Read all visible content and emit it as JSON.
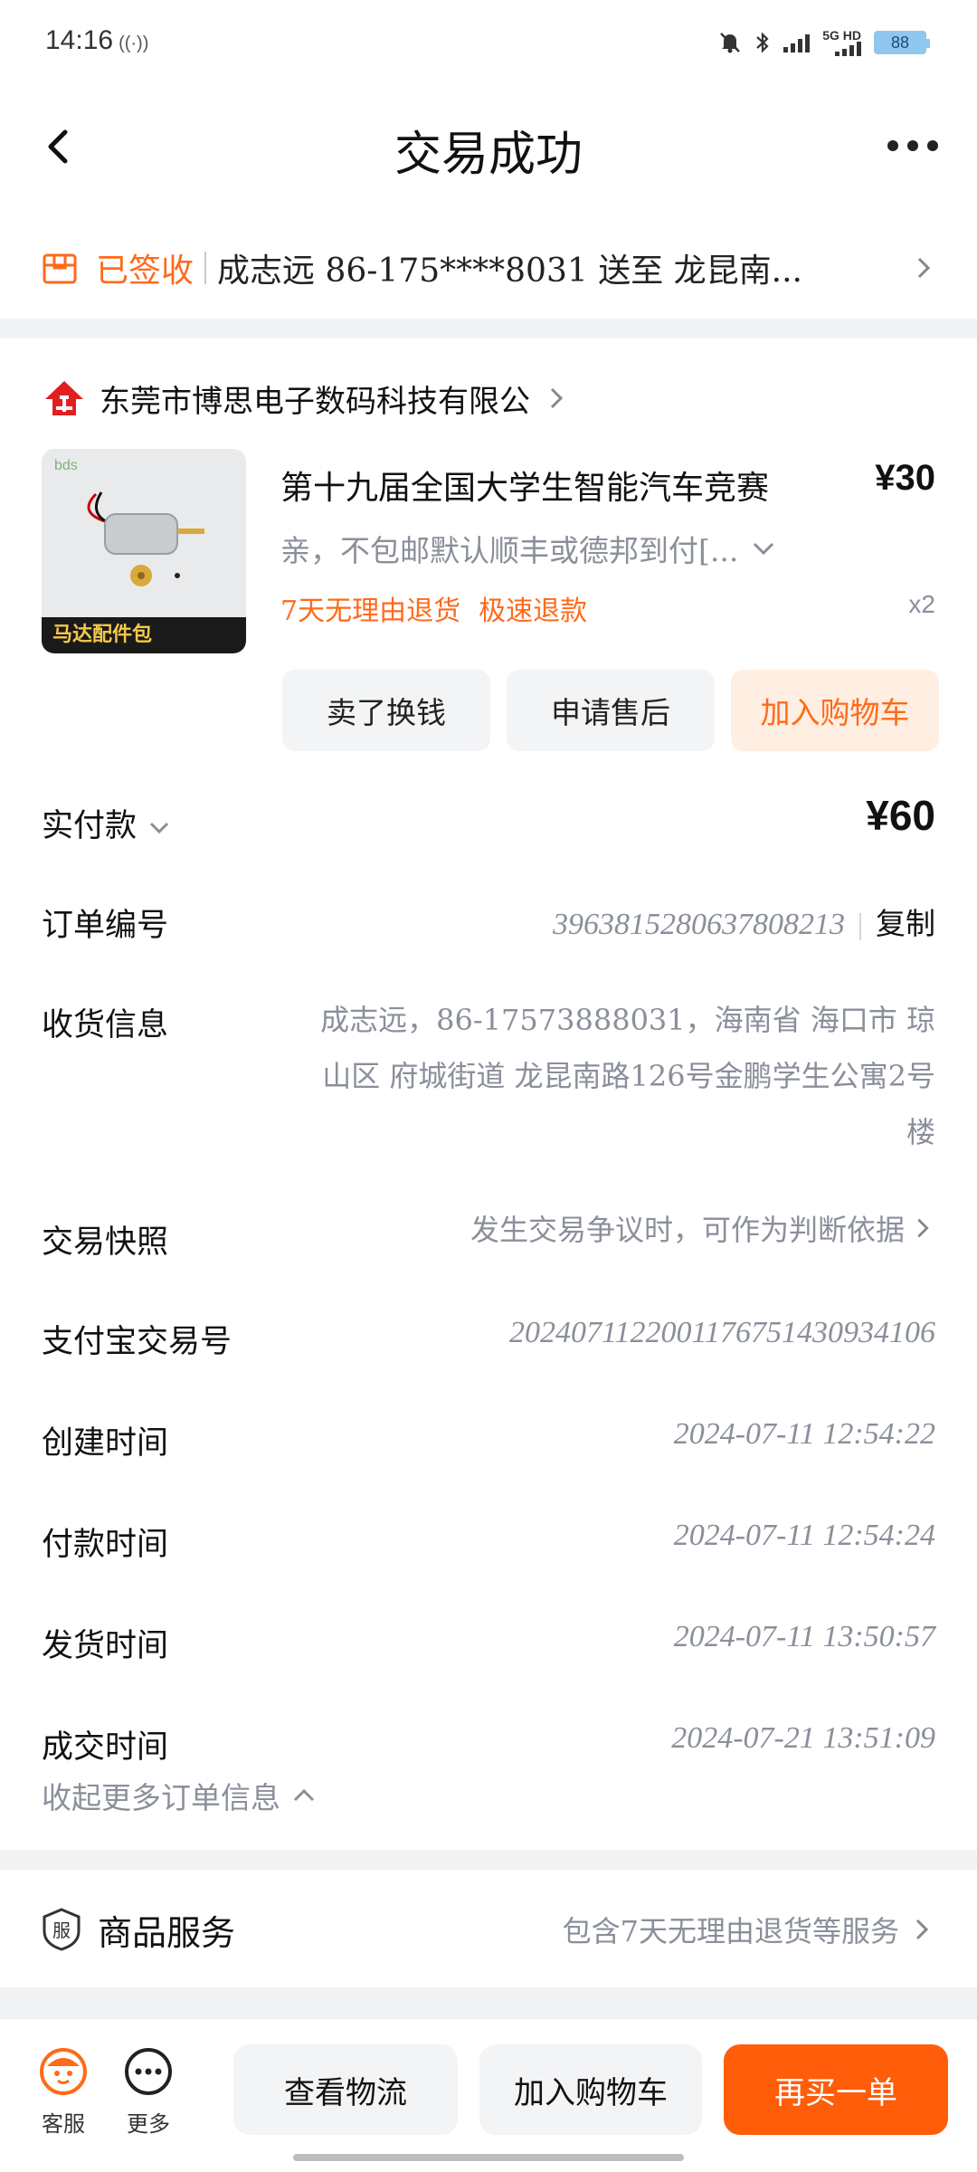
{
  "status_bar": {
    "time": "14:16",
    "net": "5G HD",
    "battery": "88"
  },
  "nav": {
    "title": "交易成功"
  },
  "delivery": {
    "status": "已签收",
    "text": "成志远 86-175****8031 送至 龙昆南..."
  },
  "shop": {
    "name": "东莞市博思电子数码科技有限公"
  },
  "product": {
    "title": "第十九届全国大学生智能汽车竞赛",
    "price": "¥30",
    "spec": "亲，不包邮默认顺丰或德邦到付[...",
    "tags": [
      "7天无理由退货",
      "极速退款"
    ],
    "qty": "x2",
    "image_tag": "马达配件包",
    "image_logo": "bds"
  },
  "actions": [
    "卖了换钱",
    "申请售后",
    "加入购物车"
  ],
  "order": {
    "paid_label": "实付款",
    "paid_amount": "¥60",
    "number_label": "订单编号",
    "number_value": "3963815280637808213",
    "copy_label": "复制",
    "address_label": "收货信息",
    "address_value": "成志远，86-17573888031，海南省 海口市 琼山区 府城街道 龙昆南路126号金鹏学生公寓2号楼",
    "snapshot_label": "交易快照",
    "snapshot_value": "发生交易争议时，可作为判断依据",
    "alipay_label": "支付宝交易号",
    "alipay_value": "2024071122001176751430934106",
    "created_label": "创建时间",
    "created_value": "2024-07-11 12:54:22",
    "paid_time_label": "付款时间",
    "paid_time_value": "2024-07-11 12:54:24",
    "shipped_label": "发货时间",
    "shipped_value": "2024-07-11 13:50:57",
    "deal_label": "成交时间",
    "deal_value": "2024-07-21 13:51:09",
    "collapse_label": "收起更多订单信息"
  },
  "service": {
    "label": "商品服务",
    "value": "包含7天无理由退货等服务"
  },
  "bottom": {
    "cs_label": "客服",
    "more_label": "更多",
    "logistics": "查看物流",
    "add_cart": "加入购物车",
    "rebuy": "再买一单"
  },
  "colors": {
    "accent": "#ff6a1a",
    "primary_button": "#ff5d0a",
    "muted_text": "#8a8f9a",
    "section_gap": "#f2f3f5"
  }
}
